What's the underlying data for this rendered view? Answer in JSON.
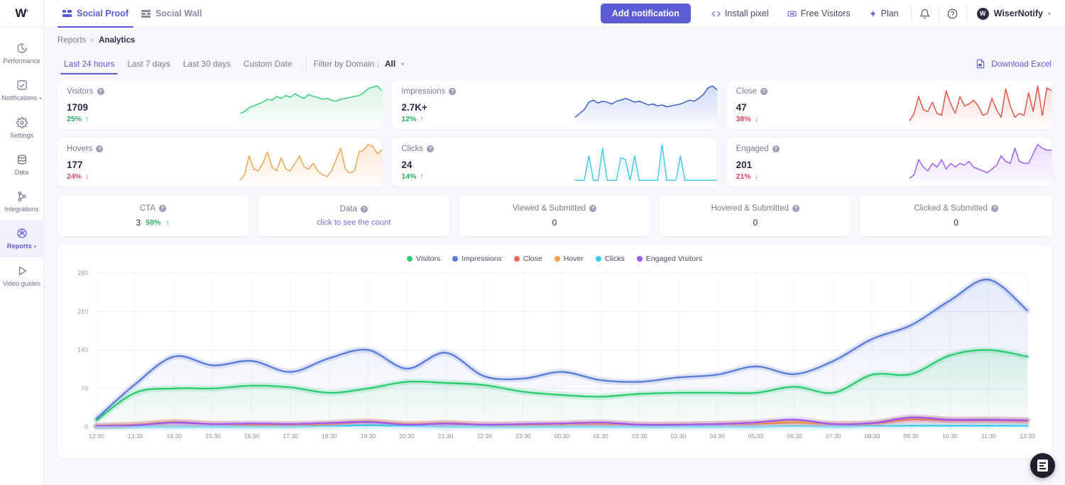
{
  "topbar": {
    "logo": "W",
    "logo_sup": "+",
    "tabs": [
      {
        "label": "Social Proof",
        "icon": "grid-icon",
        "active": true
      },
      {
        "label": "Social Wall",
        "icon": "wall-icon",
        "active": false
      }
    ],
    "add_notification": "Add notification",
    "links": [
      {
        "label": "Install pixel",
        "icon": "code-icon"
      },
      {
        "label": "Free Visitors",
        "icon": "ticket-icon"
      },
      {
        "label": "Plan",
        "icon": "bolt-icon"
      }
    ],
    "bell_icon": "bell-icon",
    "help_icon": "help-icon",
    "account": "WiserNotify",
    "account_initial": "W"
  },
  "sidebar": {
    "items": [
      {
        "label": "Performance",
        "icon": "performance-icon",
        "active": false,
        "caret": false
      },
      {
        "label": "Notifications",
        "icon": "notifications-icon",
        "active": false,
        "caret": true
      },
      {
        "label": "Settings",
        "icon": "gear-icon",
        "active": false,
        "caret": false
      },
      {
        "label": "Data",
        "icon": "database-icon",
        "active": false,
        "caret": false
      },
      {
        "label": "Integrations",
        "icon": "integrations-icon",
        "active": false,
        "caret": false
      },
      {
        "label": "Reports",
        "icon": "reports-icon",
        "active": true,
        "caret": true
      },
      {
        "label": "Video guides",
        "icon": "play-icon",
        "active": false,
        "caret": false
      }
    ]
  },
  "breadcrumb": {
    "parent": "Reports",
    "separator": ">",
    "current": "Analytics"
  },
  "filters": {
    "ranges": [
      {
        "label": "Last 24 hours",
        "active": true
      },
      {
        "label": "Last 7 days",
        "active": false
      },
      {
        "label": "Last 30 days",
        "active": false
      },
      {
        "label": "Custom Date",
        "active": false
      }
    ],
    "domain_label": "Filter by Domain :",
    "domain_value": "All",
    "download": "Download Excel",
    "download_icon": "excel-icon"
  },
  "stat_cards": [
    {
      "title": "Visitors",
      "value": "1709",
      "delta": "25%",
      "dir": "up",
      "color": "#2ecc71",
      "fill": "#d8f5e4",
      "spark": [
        30,
        28,
        24,
        22,
        20,
        18,
        15,
        16,
        12,
        14,
        11,
        13,
        9,
        12,
        14,
        10,
        12,
        13,
        15,
        14,
        16,
        17,
        15,
        14,
        13,
        12,
        11,
        8,
        4,
        2,
        1,
        6
      ]
    },
    {
      "title": "Impressions",
      "value": "2.7K+",
      "delta": "12%",
      "dir": "up",
      "color": "#3355cc",
      "fill": "#cfd9f7",
      "spark": [
        34,
        30,
        26,
        18,
        16,
        19,
        17,
        18,
        20,
        17,
        16,
        14,
        16,
        18,
        17,
        19,
        21,
        20,
        22,
        21,
        23,
        22,
        21,
        20,
        18,
        16,
        17,
        14,
        10,
        3,
        1,
        5
      ]
    },
    {
      "title": "Close",
      "value": "47",
      "delta": "38%",
      "dir": "down",
      "color": "#e74c3c",
      "fill": "#fadbd8",
      "spark": [
        38,
        30,
        12,
        26,
        28,
        18,
        30,
        32,
        6,
        20,
        30,
        12,
        22,
        20,
        16,
        22,
        32,
        30,
        14,
        26,
        34,
        4,
        22,
        34,
        30,
        32,
        8,
        28,
        1,
        32,
        3,
        6
      ]
    },
    {
      "title": "Hovers",
      "value": "177",
      "delta": "24%",
      "dir": "down",
      "color": "#f0a04b",
      "fill": "#fce8d2",
      "spark": [
        40,
        34,
        14,
        28,
        30,
        22,
        10,
        26,
        30,
        16,
        28,
        30,
        22,
        14,
        26,
        28,
        22,
        30,
        34,
        36,
        30,
        18,
        6,
        28,
        32,
        30,
        10,
        8,
        2,
        4,
        12,
        8
      ]
    },
    {
      "title": "Clicks",
      "value": "24",
      "delta": "14%",
      "dir": "up",
      "color": "#3bc8ef",
      "fill": "#d3f2fb",
      "spark": [
        40,
        40,
        40,
        14,
        40,
        40,
        6,
        40,
        40,
        40,
        16,
        18,
        40,
        14,
        40,
        40,
        40,
        40,
        40,
        2,
        40,
        40,
        40,
        14,
        40,
        40,
        40,
        40,
        40,
        40,
        40,
        40
      ]
    },
    {
      "title": "Engaged",
      "value": "201",
      "delta": "21%",
      "dir": "down",
      "color": "#9b59f5",
      "fill": "#e8d9fc",
      "spark": [
        38,
        34,
        18,
        26,
        30,
        22,
        26,
        18,
        28,
        22,
        26,
        22,
        24,
        20,
        26,
        28,
        30,
        32,
        28,
        24,
        14,
        20,
        22,
        6,
        20,
        22,
        22,
        12,
        2,
        6,
        8,
        8
      ]
    }
  ],
  "mini_cards": [
    {
      "title": "CTA",
      "value": "3",
      "pct": "50%",
      "dir": "up",
      "link": null
    },
    {
      "title": "Data",
      "value": null,
      "pct": null,
      "dir": null,
      "link": "click to see the count"
    },
    {
      "title": "Viewed & Submitted",
      "value": "0",
      "pct": null,
      "dir": null,
      "link": null
    },
    {
      "title": "Hovered & Submitted",
      "value": "0",
      "pct": null,
      "dir": null,
      "link": null
    },
    {
      "title": "Clicked & Submitted",
      "value": "0",
      "pct": null,
      "dir": null,
      "link": null
    }
  ],
  "chart_data": {
    "type": "line",
    "title": "",
    "xlabel": "",
    "ylabel": "",
    "ylim": [
      0,
      280
    ],
    "yticks": [
      0,
      70,
      140,
      210,
      280
    ],
    "grid": true,
    "legend_position": "top-center",
    "x": [
      "12:30",
      "13:30",
      "14:30",
      "15:30",
      "16:30",
      "17:30",
      "18:30",
      "19:30",
      "20:30",
      "21:30",
      "22:30",
      "23:30",
      "00:30",
      "01:30",
      "02:30",
      "03:30",
      "04:30",
      "05:30",
      "06:30",
      "07:30",
      "08:30",
      "09:30",
      "10:30",
      "11:30",
      "12:30"
    ],
    "series": [
      {
        "name": "Visitors",
        "color": "#2ecc71",
        "values": [
          12,
          62,
          70,
          70,
          75,
          72,
          62,
          70,
          82,
          80,
          76,
          64,
          58,
          55,
          60,
          62,
          62,
          62,
          73,
          62,
          95,
          96,
          130,
          140,
          128
        ]
      },
      {
        "name": "Impressions",
        "color": "#5b7cd8",
        "values": [
          15,
          78,
          128,
          112,
          120,
          100,
          125,
          140,
          106,
          135,
          92,
          88,
          100,
          85,
          82,
          90,
          95,
          110,
          96,
          120,
          160,
          185,
          230,
          268,
          212
        ]
      },
      {
        "name": "Close",
        "color": "#e8695c",
        "values": [
          2,
          4,
          8,
          5,
          4,
          4,
          5,
          9,
          5,
          6,
          4,
          4,
          5,
          6,
          4,
          4,
          5,
          6,
          8,
          5,
          6,
          14,
          12,
          12,
          11
        ]
      },
      {
        "name": "Hover",
        "color": "#f0a04b",
        "values": [
          1,
          4,
          9,
          5,
          5,
          4,
          6,
          10,
          5,
          7,
          4,
          4,
          5,
          7,
          4,
          4,
          5,
          7,
          9,
          5,
          7,
          16,
          13,
          13,
          12
        ]
      },
      {
        "name": "Clicks",
        "color": "#3bc8ef",
        "values": [
          0,
          0,
          0,
          0,
          0,
          0,
          1,
          3,
          1,
          0,
          0,
          0,
          0,
          0,
          0,
          0,
          0,
          0,
          1,
          0,
          1,
          2,
          2,
          2,
          2
        ]
      },
      {
        "name": "Engaged Visitors",
        "color": "#9b59f5",
        "values": [
          1,
          3,
          8,
          5,
          6,
          5,
          7,
          9,
          4,
          6,
          4,
          5,
          6,
          8,
          4,
          4,
          5,
          8,
          13,
          5,
          7,
          17,
          13,
          13,
          12
        ]
      }
    ]
  },
  "fab": {
    "icon": "chat-sheet-icon"
  }
}
